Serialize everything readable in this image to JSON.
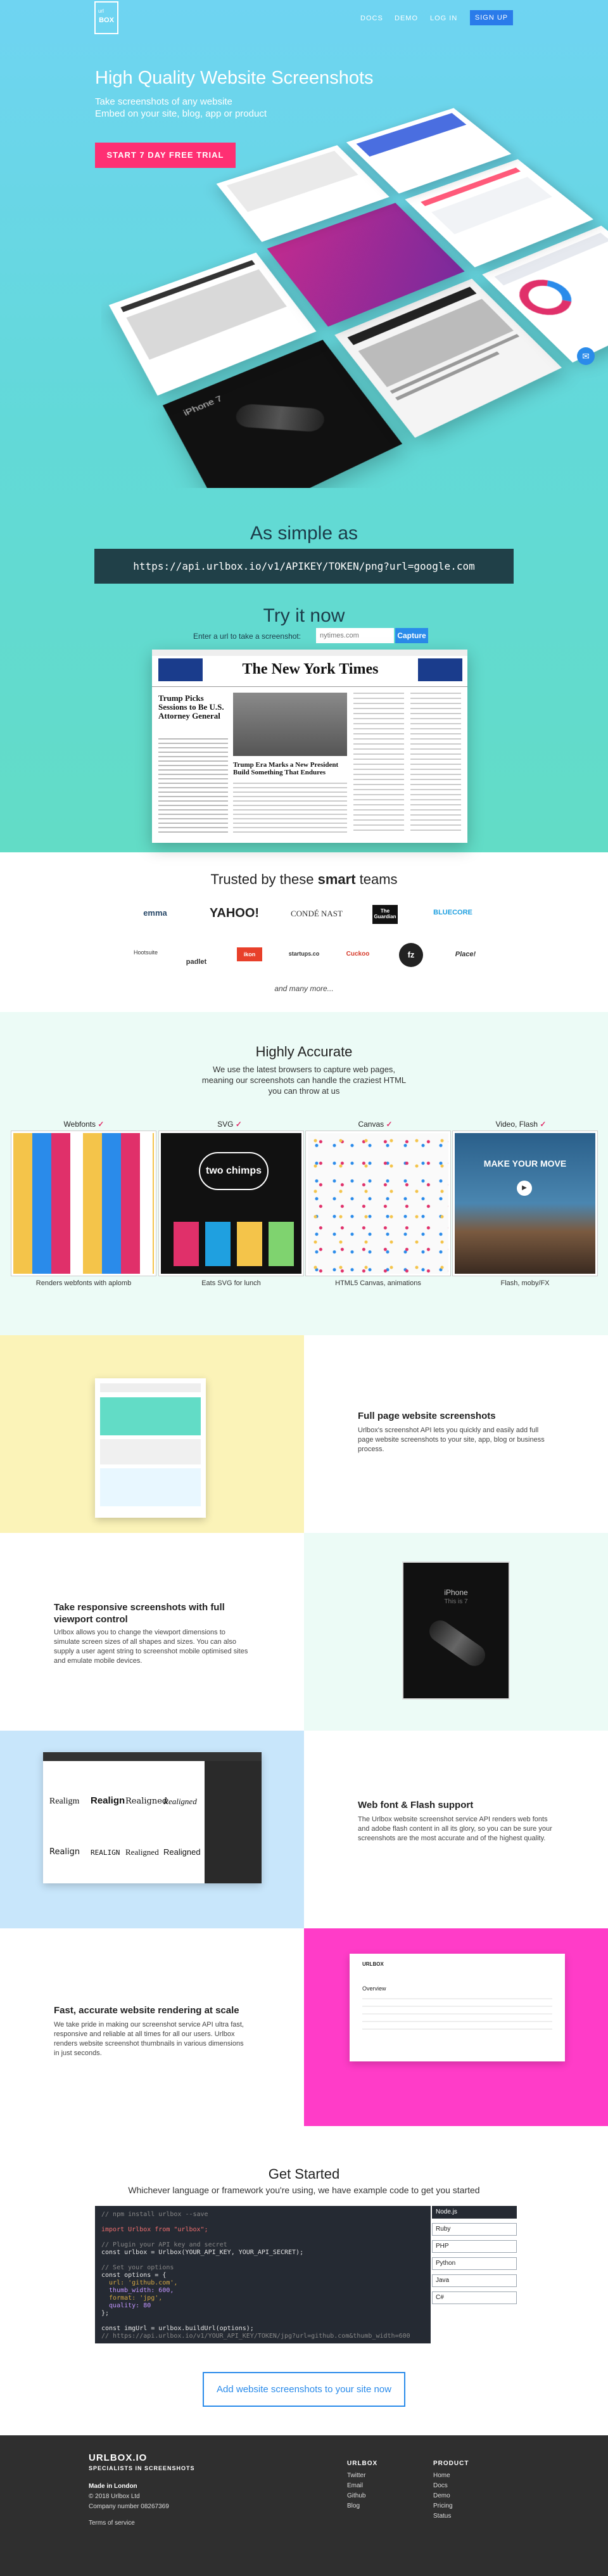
{
  "header": {
    "logo_small": "url",
    "logo_text": "BOX",
    "nav": [
      "DOCS",
      "DEMO",
      "LOG IN"
    ],
    "signup": "SIGN UP"
  },
  "hero": {
    "title": "High Quality Website Screenshots",
    "subtitle_1": "Take screenshots of any website",
    "subtitle_2": "Embed on your site, blog, app or product",
    "cta": "START 7 DAY FREE TRIAL",
    "mock_iphone_text": "iPhone 7"
  },
  "simple": {
    "title": "As simple as",
    "url": "https://api.urlbox.io/v1/APIKEY/TOKEN/png?url=google.com"
  },
  "try_it": {
    "title": "Try it now",
    "label": "Enter a url to take a screenshot:",
    "placeholder": "nytimes.com",
    "button": "Capture",
    "preview_masthead": "The New York Times",
    "preview_headline": "Trump Picks Sessions to Be U.S. Attorney General",
    "preview_caption": "Trump Era Marks a New President Build Something That Endures"
  },
  "trusted": {
    "title_prefix": "Trusted by these ",
    "title_bold": "smart",
    "title_suffix": " teams",
    "brands_row1": [
      "emma",
      "YAHOO!",
      "CONDÉ NAST",
      "The Guardian",
      "BLUECORE"
    ],
    "brands_row2": [
      "Hootsuite",
      "padlet",
      "ikon",
      "startups.co",
      "Cuckoo",
      "fz",
      "Place!"
    ],
    "more": "and many more..."
  },
  "accurate": {
    "title": "Highly Accurate",
    "subtitle_1": "We use the latest browsers to capture web pages,",
    "subtitle_2": "meaning our screenshots can handle the craziest HTML",
    "subtitle_3": "you can throw at us",
    "check": "✓",
    "features": [
      {
        "label": "Webfonts",
        "caption": "Renders webfonts with aplomb"
      },
      {
        "label": "SVG",
        "caption": "Eats SVG for lunch"
      },
      {
        "label": "Canvas",
        "caption": "HTML5 Canvas, animations"
      },
      {
        "label": "Video, Flash",
        "caption": "Flash, moby/FX"
      }
    ],
    "svg_text": "two chimps",
    "video_text": "MAKE YOUR MOVE"
  },
  "rows": {
    "full_page": {
      "title": "Full page website screenshots",
      "body": "Urlbox's screenshot API lets you quickly and easily add full page website screenshots to your site, app, blog or business process."
    },
    "responsive": {
      "title": "Take responsive screenshots with full viewport control",
      "body": "Urlbox allows you to change the viewport dimensions to simulate screen sizes of all shapes and sizes. You can also supply a user agent string to screenshot mobile optimised sites and emulate mobile devices.",
      "phone_text_1": "iPhone",
      "phone_text_2": "This is 7"
    },
    "webfont": {
      "title": "Web font & Flash support",
      "body": "The Urlbox website screenshot service API renders web fonts and adobe flash content in all its glory, so you can be sure your screenshots are the most accurate and of the highest quality.",
      "font_samples": [
        "Realigm",
        "Realign",
        "Realigned",
        "Realigned",
        "Realign",
        "REALIGN",
        "Realigned",
        "Realigned"
      ]
    },
    "fast": {
      "title_prefix": "Fast, accurate website rendering at ",
      "title_bold": "scale",
      "body": "We take pride in making our screenshot service API ultra fast, responsive and reliable at all times for all our users. Urlbox renders website screenshot thumbnails in various dimensions in just seconds.",
      "mock_logo": "URLBOX",
      "mock_heading": "Overview"
    }
  },
  "get_started": {
    "title": "Get Started",
    "subtitle": "Whichever language or framework you're using, we have example code to get you started",
    "code_lines": [
      {
        "cls": "c",
        "text": "// npm install urlbox --save"
      },
      {
        "cls": "",
        "text": ""
      },
      {
        "cls": "k",
        "text": "import Urlbox from \"urlbox\";"
      },
      {
        "cls": "",
        "text": ""
      },
      {
        "cls": "c",
        "text": "// Plugin your API key and secret"
      },
      {
        "cls": "",
        "text": "const urlbox = Urlbox(YOUR_API_KEY, YOUR_API_SECRET);"
      },
      {
        "cls": "",
        "text": ""
      },
      {
        "cls": "c",
        "text": "// Set your options"
      },
      {
        "cls": "",
        "text": "const options = {"
      },
      {
        "cls": "s",
        "text": "  url: 'github.com',"
      },
      {
        "cls": "n",
        "text": "  thumb_width: 600,"
      },
      {
        "cls": "s",
        "text": "  format: 'jpg',"
      },
      {
        "cls": "n",
        "text": "  quality: 80"
      },
      {
        "cls": "",
        "text": "};"
      },
      {
        "cls": "",
        "text": ""
      },
      {
        "cls": "",
        "text": "const imgUrl = urlbox.buildUrl(options);"
      },
      {
        "cls": "c",
        "text": "// https://api.urlbox.io/v1/YOUR_API_KEY/TOKEN/jpg?url=github.com&thumb_width=600"
      },
      {
        "cls": "",
        "text": ""
      },
      {
        "cls": "c",
        "text": "// Now set it as the src in an img tag to render the screenshot"
      },
      {
        "cls": "p",
        "text": "<img src={imgUrl} />"
      }
    ],
    "languages": [
      "Node.js",
      "Ruby",
      "PHP",
      "Python",
      "Java",
      "C#"
    ],
    "cta": "Add website screenshots to your site now"
  },
  "footer": {
    "brand": "URLBOX.IO",
    "tagline": "SPECIALISTS IN SCREENSHOTS",
    "made_in": "Made in London",
    "copyright": "© 2018 Urlbox Ltd",
    "company": "Company number 08267369",
    "terms": "Terms of service",
    "col1_title": "URLBOX",
    "col1": [
      "Twitter",
      "Email",
      "Github",
      "Blog"
    ],
    "col2_title": "PRODUCT",
    "col2": [
      "Home",
      "Docs",
      "Demo",
      "Pricing",
      "Status"
    ]
  },
  "colors": {
    "accent": "#ff2f73",
    "primary": "#2a8bea",
    "hero_top": "#6fd4f2",
    "hero_bottom": "#62dcc6",
    "yellow_panel": "#fbf3b8",
    "mint_panel": "#ecfbf6",
    "blue_panel": "#c8e6fb",
    "pink_panel": "#ff3cc8",
    "footer": "#2f2f2f"
  }
}
